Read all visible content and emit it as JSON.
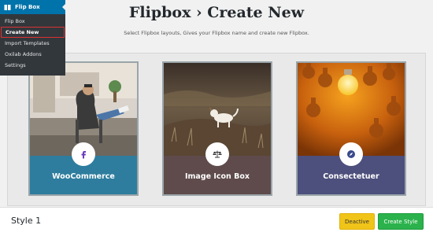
{
  "admin_menu": {
    "title": "Flip Box",
    "items": [
      {
        "label": "Flip Box"
      },
      {
        "label": "Create New",
        "active": true
      },
      {
        "label": "Import Templates"
      },
      {
        "label": "Oxilab Addons"
      },
      {
        "label": "Settings"
      }
    ]
  },
  "header": {
    "title": "Flipbox › Create New",
    "subtitle": "Select Flipbox layouts, Gives your Flipbox name and create new Flipbox."
  },
  "cards": [
    {
      "title": "WooCommerce",
      "icon": "facebook-icon",
      "color": "#2e7d9e"
    },
    {
      "title": "Image Icon Box",
      "icon": "scale-icon",
      "color": "#5f4b4b"
    },
    {
      "title": "Consectetuer",
      "icon": "compass-icon",
      "color": "#4d4f7c"
    }
  ],
  "footer": {
    "style_label": "Style 1",
    "deactive_label": "Deactive",
    "create_label": "Create Style"
  }
}
